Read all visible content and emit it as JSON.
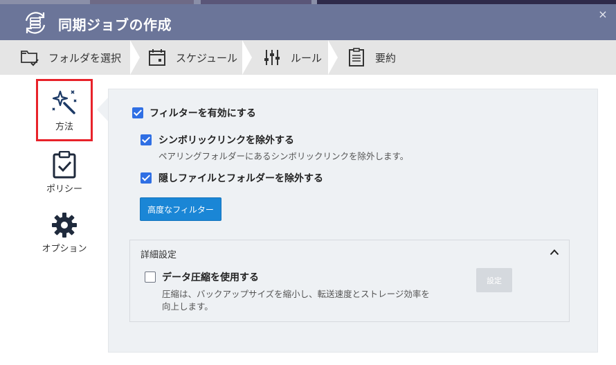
{
  "dialog": {
    "title": "同期ジョブの作成",
    "close_label": "×"
  },
  "steps": [
    {
      "label": "フォルダを選択",
      "icon": "folder-select-icon"
    },
    {
      "label": "スケジュール",
      "icon": "calendar-icon"
    },
    {
      "label": "ルール",
      "icon": "sliders-icon"
    },
    {
      "label": "要約",
      "icon": "clipboard-list-icon"
    }
  ],
  "sidebar": {
    "items": [
      {
        "label": "方法",
        "icon": "magic-wand-icon",
        "active": true
      },
      {
        "label": "ポリシー",
        "icon": "clipboard-check-icon",
        "active": false
      },
      {
        "label": "オプション",
        "icon": "gear-icon",
        "active": false
      }
    ]
  },
  "rules": {
    "enable_filter": {
      "label": "フィルターを有効にする",
      "checked": true
    },
    "exclude_symlinks": {
      "label": "シンボリックリンクを除外する",
      "description": "ペアリングフォルダーにあるシンボリックリンクを除外します。",
      "checked": true
    },
    "exclude_hidden": {
      "label": "隠しファイルとフォルダーを除外する",
      "checked": true
    },
    "advanced_filter_button": "高度なフィルター"
  },
  "details": {
    "title": "詳細設定",
    "compression": {
      "label": "データ圧縮を使用する",
      "description_line1": "圧縮は、バックアップサイズを縮小し、転送速度とストレージ効率を",
      "description_line2": "向上します。",
      "checked": false
    },
    "settings_button": "設定"
  },
  "colors": {
    "titlebar": "#6b7599",
    "accent_blue": "#1a86d6",
    "checkbox_blue": "#2f6fe4",
    "highlight_red": "#e8222a",
    "panel_bg": "#eef1f4"
  }
}
